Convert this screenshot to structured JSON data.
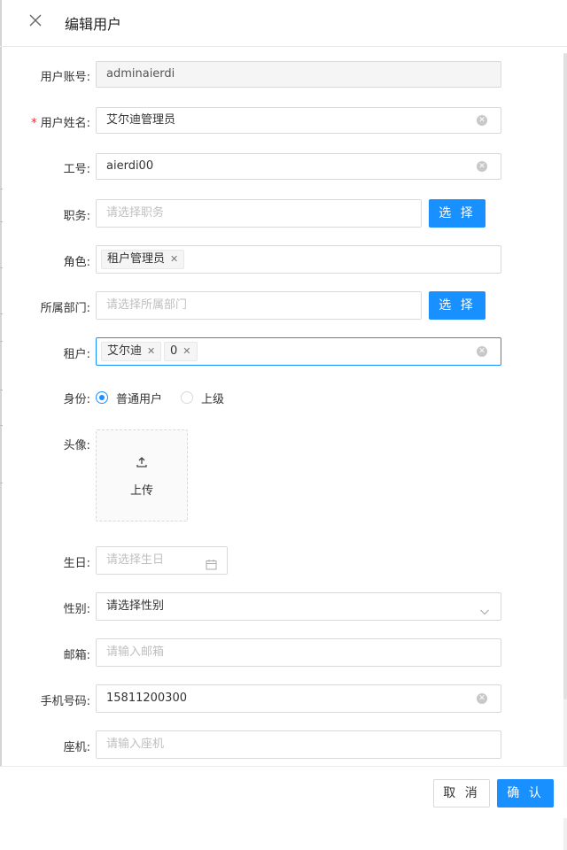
{
  "dialog": {
    "title": "编辑用户"
  },
  "fields": {
    "account": {
      "label": "用户账号:",
      "value": "adminaierdi"
    },
    "name": {
      "required_mark": "*",
      "label": "用户姓名:",
      "value": "艾尔迪管理员"
    },
    "job_no": {
      "label": "工号:",
      "value": "aierdi00"
    },
    "position": {
      "label": "职务:",
      "placeholder": "请选择职务",
      "button": "选 择"
    },
    "role": {
      "label": "角色:",
      "tags": [
        "租户管理员"
      ]
    },
    "department": {
      "label": "所属部门:",
      "placeholder": "请选择所属部门",
      "button": "选 择"
    },
    "tenant": {
      "label": "租户:",
      "tags": [
        "艾尔迪",
        "0"
      ]
    },
    "identity": {
      "label": "身份:",
      "options": [
        "普通用户",
        "上级"
      ],
      "selected": "普通用户"
    },
    "avatar": {
      "label": "头像:",
      "upload_text": "上传"
    },
    "birthday": {
      "label": "生日:",
      "placeholder": "请选择生日"
    },
    "gender": {
      "label": "性别:",
      "value": "请选择性别"
    },
    "email": {
      "label": "邮箱:",
      "placeholder": "请输入邮箱"
    },
    "phone": {
      "label": "手机号码:",
      "value": "15811200300"
    },
    "landline": {
      "label": "座机:",
      "placeholder": "请输入座机"
    }
  },
  "footer": {
    "cancel_label": "取 消",
    "confirm_label": "确 认"
  },
  "icons": {
    "close": "close-icon",
    "clear": "clear-circle-icon",
    "tag_close": "tag-close-icon",
    "upload": "upload-icon",
    "calendar": "calendar-icon",
    "dropdown": "chevron-down-icon"
  },
  "colors": {
    "primary": "#1890ff",
    "required": "#f5222d",
    "border": "#d9d9d9",
    "disabled_bg": "#f5f5f5"
  }
}
